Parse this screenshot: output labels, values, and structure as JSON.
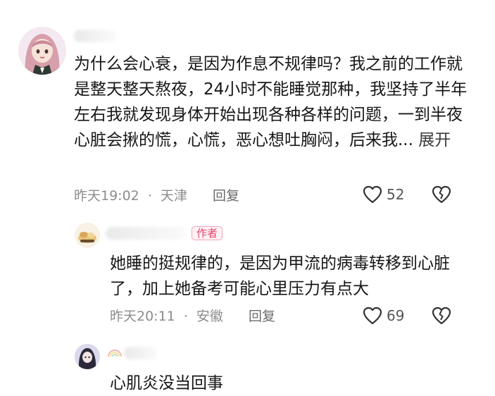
{
  "comment1": {
    "text": "为什么会心衰，是因为作息不规律吗？我之前的工作就是整天整天熬夜，24小时不能睡觉那种，我坚持了半年左右我就发现身体开始出现各种各样的问题，一到半夜心脏会揪的慌，心慌，恶心想吐胸闷，后来我...",
    "more_label": "展开",
    "time": "昨天19:02",
    "sep": "·",
    "location": "天津",
    "reply_label": "回复",
    "likes": "52",
    "like_icon": "heart-outline-icon",
    "dislike_icon": "broken-heart-icon"
  },
  "reply1": {
    "badge": "作者",
    "text": "她睡的挺规律的，是因为甲流的病毒转移到心脏了，加上她备考可能心里压力有点大",
    "time": "昨天20:11",
    "sep": "·",
    "location": "安徽",
    "reply_label": "回复",
    "likes": "69"
  },
  "reply2": {
    "text": "心肌炎没当回事"
  }
}
